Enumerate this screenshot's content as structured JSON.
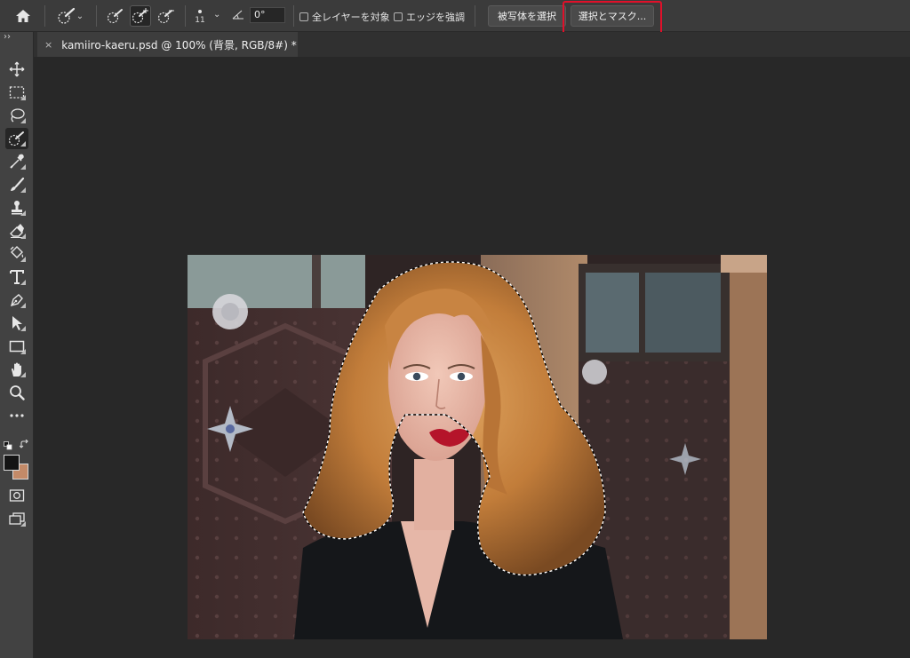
{
  "options_bar": {
    "home_icon": "home-icon",
    "tool_preset_icon": "quick-selection-preset-icon",
    "mode_new_icon": "new-selection-brush-icon",
    "mode_add_icon": "add-to-selection-brush-icon",
    "mode_subtract_icon": "subtract-from-selection-brush-icon",
    "brush_size": "11",
    "angle_value": "0°",
    "sample_all_layers_label": "全レイヤーを対象",
    "sample_all_layers_checked": false,
    "enhance_edge_label": "エッジを強調",
    "enhance_edge_checked": false,
    "select_subject_label": "被写体を選択",
    "select_and_mask_label": "選択とマスク...",
    "highlight_color": "#e0102a"
  },
  "toolbar": {
    "collapse_label": "››",
    "tools": [
      {
        "name": "move-tool"
      },
      {
        "name": "rectangular-marquee-tool"
      },
      {
        "name": "lasso-tool"
      },
      {
        "name": "quick-selection-tool",
        "active": true
      },
      {
        "name": "eyedropper-tool"
      },
      {
        "name": "brush-tool"
      },
      {
        "name": "clone-stamp-tool"
      },
      {
        "name": "eraser-tool"
      },
      {
        "name": "paint-bucket-tool"
      },
      {
        "name": "type-tool"
      },
      {
        "name": "pen-tool"
      },
      {
        "name": "path-selection-tool"
      },
      {
        "name": "rectangle-tool"
      },
      {
        "name": "hand-tool"
      },
      {
        "name": "zoom-tool"
      },
      {
        "name": "more-tools"
      }
    ],
    "foreground_color": "#141414",
    "background_color": "#c38a68"
  },
  "document": {
    "tab_title": "kamiiro-kaeru.psd @ 100% (背景, RGB/8#) *",
    "close_icon": "close-icon"
  },
  "canvas": {
    "content": "photo-portrait-with-hair-selection"
  }
}
